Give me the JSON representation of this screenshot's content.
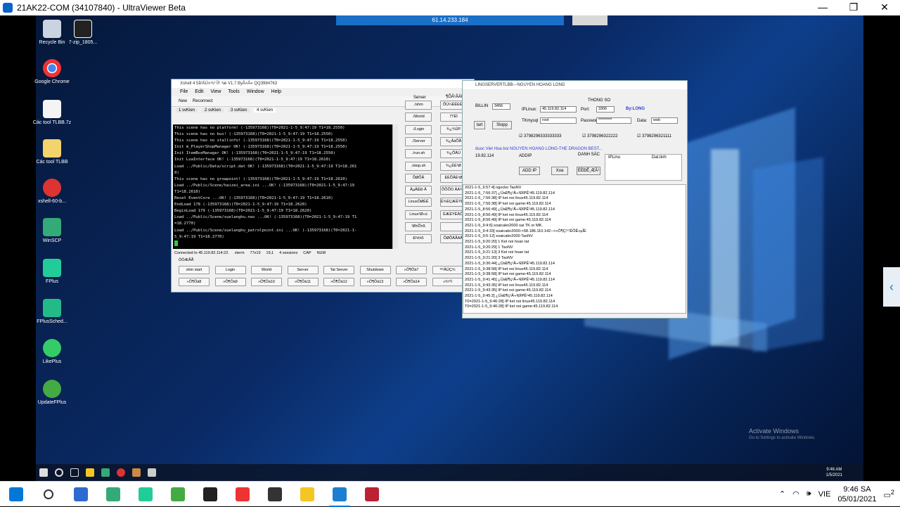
{
  "viewer": {
    "title": "21AK22-COM (34107840) - UltraViewer Beta",
    "minimize": "—",
    "restore": "❐",
    "close": "✕",
    "remote_address": "61.14.233.184"
  },
  "desktop_icons": [
    {
      "label": "Recycle Bin",
      "icon": "recycle-bin-icon",
      "color": "#c9d4e0"
    },
    {
      "label": "7-zip_1805...",
      "icon": "7zip-icon",
      "color": "#222"
    },
    {
      "label": "Google Chrome",
      "icon": "chrome-icon",
      "color": "#e33"
    },
    {
      "label": "Các tool TLBB.7z",
      "icon": "file-icon",
      "color": "#f4f4f4"
    },
    {
      "label": "Các tool TLBB",
      "icon": "folder-icon",
      "color": "#f3d36b"
    },
    {
      "label": "xshell-60-b...",
      "icon": "xshell-icon",
      "color": "#d33"
    },
    {
      "label": "WinSCP",
      "icon": "winscp-icon",
      "color": "#3a7"
    },
    {
      "label": "FPlus",
      "icon": "fplus-icon",
      "color": "#2c9"
    },
    {
      "label": "FPlusSched...",
      "icon": "fplus-sched-icon",
      "color": "#2b8"
    },
    {
      "label": "LikePlus",
      "icon": "likeplus-icon",
      "color": "#3c6"
    },
    {
      "label": "UpdateFPlus",
      "icon": "update-fplus-icon",
      "color": "#4a4"
    }
  ],
  "xshell": {
    "title": "Xshell 4 5å³ÄÜ»¾³ ÌÏ¹ ³æ V1.7 ByÅ»Å« QQ3984763",
    "menu": [
      "File",
      "Edit",
      "View",
      "Tools",
      "Window",
      "Help"
    ],
    "toolbar": [
      "New",
      "Reconnect"
    ],
    "tabs": [
      "1 svKien",
      "2 svKien",
      "3 svKien",
      "4 svKien"
    ],
    "terminal_lines": [
      "This scene has no platform! (-135973168)(T0=2021-1-5_9:47:19 T1=18.2550)",
      "This scene has no bus! (-135973168)(T0=2021-1-5_9:47:19 T1=18.2550)",
      "This scene has no stallinfo! (-135973168)(T0=2021-1-5_9:47:19 T1=18.2550)",
      "Init m_PlayerShopManager OK! (-135973168)(T0=2021-1-5_9:47:19 T1=18.2550)",
      "Init ItemBoxManager OK! (-135973168)(T0=2021-1-5_9:47:19 T1=18.2550)",
      "Init LuaInterface OK! (-135973168)(T0=2021-1-5_9:47:19 T1=18.2610)",
      "Load ../Public/Data/script.dat OK! (-135973168)(T0=2021-1-5_9:47:19 T1=18.261",
      "0)",
      "This scene has no growpoint! (-135973168)(T0=2021-1-5_9:47:19 T1=18.2610)",
      "Load ../Public/Scene/haizei_area.ini ...OK! (-135973168)(T0=2021-1-5_9:47:19",
      "T1=18.2610)",
      "Reset EventCore ...OK! (-135973168)(T0=2021-1-5_9:47:19 T1=18.2610)",
      "EndLoad 178 (-135973168)(T0=2021-1-5_9:47:19 T1=18.2620)",
      "BeginLoad 179 (-135973168)(T0=2021-1-5_9:47:19 T1=18.2620)",
      "Load ../Public/Scene/xuelanghu.nav ...OK! (-135973168)(T0=2021-1-5_9:47:19 T1",
      "=18.2770)",
      "Load ../Public/Scene/xuelanghu_patrolpoint.ini ...OK! (-135973168)(T0=2021-1-",
      "5_9:47:19 T1=18.2770)"
    ],
    "status": {
      "connected": "Connected to 45.119.82.114:22.",
      "term": "xterm",
      "size": "77x19",
      "pos": "19,1",
      "sessions": "4 sessions",
      "cap": "CAP",
      "num": "NUM"
    },
    "server_label": "Server",
    "side_header": "¶ÕÅ¹ÅÄÜ",
    "side_left": [
      "./shm",
      "./World",
      "./Login",
      "./Server",
      "./run.sh",
      "./stop.sh",
      "ÕØÕÅ",
      "ÅµÅÊÐ·Å",
      "LinuxÔØÈË",
      "Linux¹Ø»ú",
      "¹Ø±Õ±ß",
      "Ð¹ë±ß"
    ],
    "side_right": [
      "ÕÙ¼ÈÊÉÊý",
      "7TÉÌ",
      "¾¿¾ÙP",
      "¾¿ÅäÕÃ",
      "¾¿ÕÅÜ",
      "¾¿ÊÈ¹Ø",
      "ÉÈÕÅÈ¹Ø",
      "ÕÕÕÒ ÅÁ¾¿",
      "Ê¾ÈÇÆÊÝÊÂÔÍ",
      "ÊÆÊÝÊÂÔÍ",
      "",
      "ÕØÕÅÃÁÅÍ"
    ],
    "bottom_header": "ÒÒÆÅÃ",
    "bottom_row1": [
      "shm start",
      "Login",
      "World",
      "Server",
      "Tat Server",
      "Shutdown",
      "»Ô¶Ôà7",
      "¹ª¹ÅÜÇ¾"
    ],
    "bottom_row2": [
      "»Ô¶Ôà8",
      "»Ô¶Ôà9",
      "»Ô¶Ôà10",
      "»Ô¶Ôà11",
      "»Ô¶Ôà12",
      "»Ô¶Ôà13",
      "»Ô¶Ôà14",
      "»¾³¹Ì"
    ]
  },
  "server_tool": {
    "title": "LINGSERVERTLBB---NGUYEN HOANG LONG",
    "billing_label": "BILLIN",
    "billing_port": "3456",
    "start_btn": "tart",
    "stop_btn": "Stopp",
    "group_title": "THONG SO",
    "iplinux_label": "IPLinux:",
    "iplinux_value": "45.119.82.114",
    "port_label": "Port:",
    "port_value": "3306",
    "by_label": "By:LONG",
    "user_label": "TKmysql",
    "user_value": "root",
    "pass_label": "Password",
    "pass_value": "*********",
    "data_label": "Data:",
    "data_value": "web",
    "checks": [
      "3798296333333333",
      "3798296322222",
      "3798296321111"
    ],
    "marquee": "duoc Viet Hoa boi NGUYEN HOANG LONG-THE DRAGON BEST...",
    "ip_short": "19.82.114",
    "addip_label": "ADDIP",
    "danhsach_label": "DANH SÁC",
    "addip_btn": "ADD IP",
    "xoa_btn": "Xoa",
    "extra_btn": "ÉÈÐÊ¸ÆÂ¹",
    "col_ip": "IPLinu",
    "col_time": "Dat.tinh",
    "log": [
      "2021-1-5_6:57:4] ngocko TaoNV",
      "2021-1-5_7:56:37] ¿ÜsÐ¶ç¹Å¬¹ÐÌPÊ¹45.119.82.114",
      "2021-1-5_7:56:38] IP ket noi linux45.119.82.114",
      "2021-1-5_7:56:38] IP ket noi game:45.119.82.114",
      "2021-1-5_8:56:49] ¿ÜsÐ¶ç¹Å¬¹ÐÌPÊ¹45.119.82.114",
      "2021-1-5_8:56:49] IP ket noi linux45.119.82.114",
      "2021-1-5_8:56:49] IP ket noi game:45.119.82.114",
      "2021-1-5_9:4:6] soaicakn2000 sai TK or MK.",
      "2021-1-5_9:4:33] soaicakn2000->58.186.110.142-->»Ô¶Ç¹¹¹ÊÔÊ»µÎÈ",
      "2021-1-5_9:5:12] soaicakn2000 TaoNV",
      "2021-1-5_9:20:20] 1 Ket noi hoan tat",
      "2021-1-5_9:20:29] 1 TaoNV",
      "2021-1-5_9:21:13] 3 Ket noi hoan tat",
      "2021-1-5_9:21:20] 3 TaoNV",
      "2021-1-5_9:36:44] ¿ÜsÐ¶ç¹Å¬¹ÐÌPÊ¹45.119.82.114",
      "2021-1-5_9:38:58] IP ket noi linux45.119.82.114",
      "2021-1-5_9:38:58] IP ket noi game:45.119.82.114",
      "2021-1-5_9:41:45] ¿ÜsÐ¶ç¹Å¬¹ÐÌPÊ¹45.119.82.114",
      "2021-1-5_9:43:35] IP ket noi linux45.119.82.114",
      "2021-1-5_9:43:35] IP ket noi game:45.119.82.114",
      "2021-1-5_9:45:2] ¿ÜsÐ¶ç¹Å¬¹ÐÌPÊ¹45.119.82.114",
      "T0=2021-1-5_9:46:28] IP ket noi linux45.119.82.114",
      "T0=2021-1-5_9:46:28] IP ket noi game:45.119.82.114"
    ]
  },
  "activate": {
    "line1": "Activate Windows",
    "line2": "Go to Settings to activate Windows."
  },
  "inner_taskbar": {
    "time": "9:46 AM",
    "date": "1/5/2021"
  },
  "taskbar": {
    "apps": [
      {
        "icon": "windows-start-icon",
        "color": "#0078d7"
      },
      {
        "icon": "search-icon",
        "color": "#333"
      },
      {
        "icon": "remote-desktop-icon",
        "color": "#2e6bd1"
      },
      {
        "icon": "network-tool-icon",
        "color": "#3a7"
      },
      {
        "icon": "refresh-tool-icon",
        "color": "#2c9"
      },
      {
        "icon": "notepad-icon",
        "color": "#4a4"
      },
      {
        "icon": "game-icon",
        "color": "#222"
      },
      {
        "icon": "chrome-icon",
        "color": "#e33"
      },
      {
        "icon": "game2-icon",
        "color": "#333"
      },
      {
        "icon": "emoji-app-icon",
        "color": "#f3c623"
      },
      {
        "icon": "ultraviewer-icon",
        "color": "#1a7fd1"
      },
      {
        "icon": "app-a-icon",
        "color": "#b23"
      }
    ],
    "lang": "VIE",
    "time": "9:46 SA",
    "date": "05/01/2021",
    "notifications": "2"
  }
}
